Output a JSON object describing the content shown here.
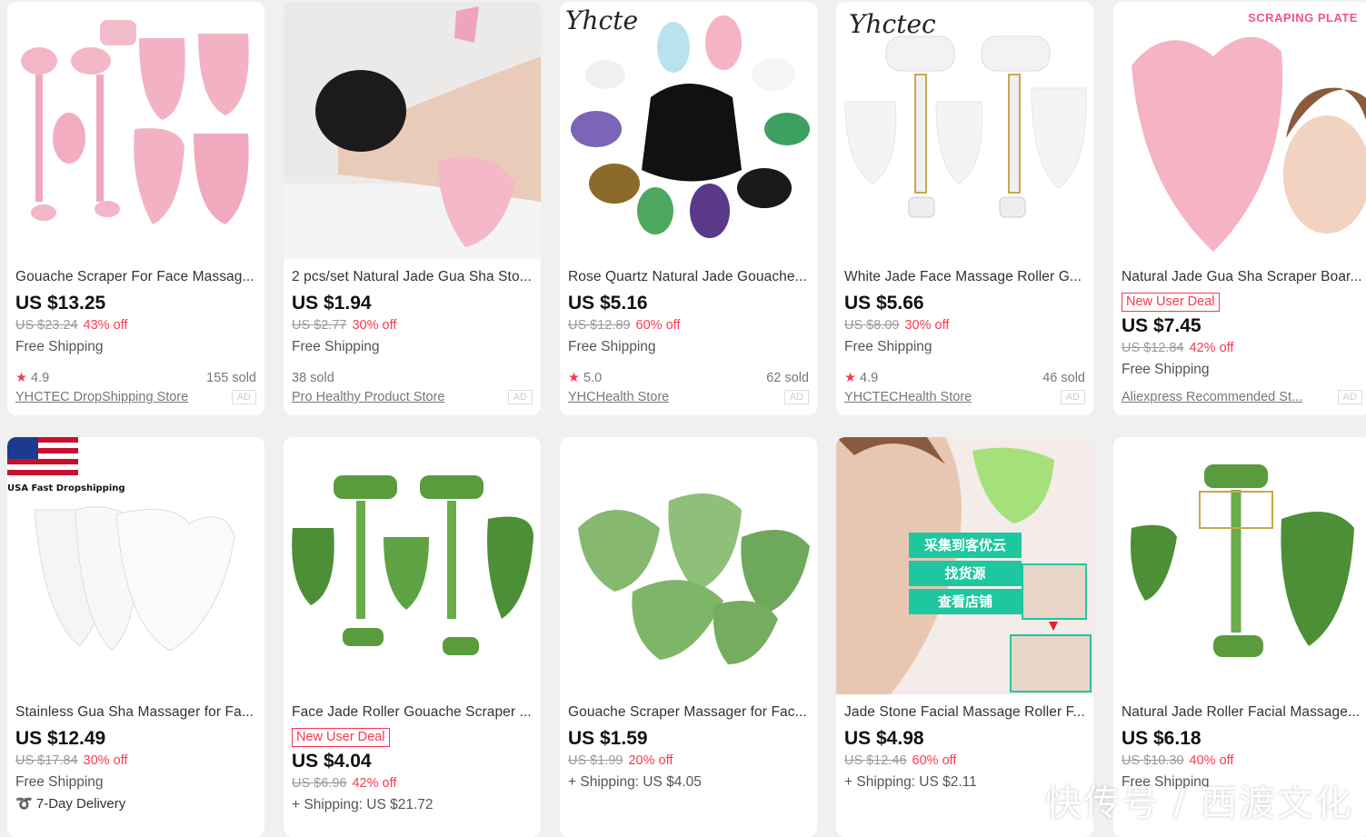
{
  "products": [
    {
      "title": "Gouache Scraper For Face Massag...",
      "price": "US $13.25",
      "original": "US $23.24",
      "discount": "43% off",
      "shipping": "Free Shipping",
      "rating": "4.9",
      "sold": "155 sold",
      "store": "YHCTEC DropShipping Store",
      "ad": "AD"
    },
    {
      "title": "2 pcs/set Natural Jade Gua Sha Sto...",
      "price": "US $1.94",
      "original": "US $2.77",
      "discount": "30% off",
      "shipping": "Free Shipping",
      "rating": "",
      "sold": "38 sold",
      "store": "Pro Healthy Product Store",
      "ad": "AD"
    },
    {
      "title": "Rose Quartz Natural Jade Gouache...",
      "price": "US $5.16",
      "original": "US $12.89",
      "discount": "60% off",
      "shipping": "Free Shipping",
      "rating": "5.0",
      "sold": "62 sold",
      "store": "YHCHealth Store",
      "ad": "AD",
      "brand": "Yhcte"
    },
    {
      "title": "White Jade Face Massage Roller G...",
      "price": "US $5.66",
      "original": "US $8.09",
      "discount": "30% off",
      "shipping": "Free Shipping",
      "rating": "4.9",
      "sold": "46 sold",
      "store": "YHCTECHealth Store",
      "ad": "AD",
      "brand": "Yhctec"
    },
    {
      "title": "Natural Jade Gua Sha Scraper Boar...",
      "deal": "New User Deal",
      "price": "US $7.45",
      "original": "US $12.84",
      "discount": "42% off",
      "shipping": "Free Shipping",
      "store": "Aliexpress Recommended St...",
      "ad": "AD",
      "banner": "SCRAPING PLATE"
    },
    {
      "title": "Stainless Gua Sha Massager for Fa...",
      "price": "US $12.49",
      "original": "US $17.84",
      "discount": "30% off",
      "shipping": "Free Shipping",
      "delivery": "7-Day Delivery",
      "badge": "USA Fast Dropshipping"
    },
    {
      "title": "Face Jade Roller Gouache Scraper ...",
      "deal": "New User Deal",
      "price": "US $4.04",
      "original": "US $6.96",
      "discount": "42% off",
      "shipping": "+ Shipping: US $21.72"
    },
    {
      "title": "Gouache Scraper Massager for Fac...",
      "price": "US $1.59",
      "original": "US $1.99",
      "discount": "20% off",
      "shipping": "+ Shipping: US $4.05"
    },
    {
      "title": "Jade Stone Facial Massage Roller F...",
      "price": "US $4.98",
      "original": "US $12.46",
      "discount": "60% off",
      "shipping": "+ Shipping: US $2.11",
      "overlay": [
        "采集到客优云",
        "找货源",
        "查看店铺"
      ]
    },
    {
      "title": "Natural Jade Roller Facial Massage...",
      "price": "US $6.18",
      "original": "US $10.30",
      "discount": "40% off",
      "shipping": "Free Shipping"
    }
  ],
  "watermark": "快传号 / 西渡文化",
  "colors": {
    "accent": "#fd384f",
    "pink": "#f4a7bf",
    "jade": "#6aa84f",
    "teal": "#1ec7a0"
  }
}
